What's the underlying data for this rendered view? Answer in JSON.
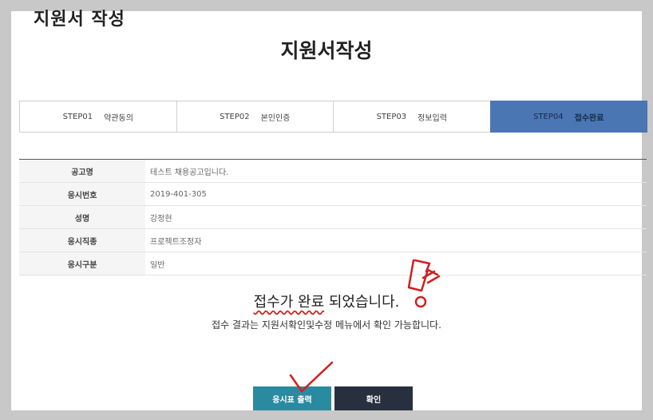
{
  "overlay_title": "지원서 작성",
  "page_title": "지원서작성",
  "steps": [
    {
      "num": "STEP01",
      "label": "약관동의"
    },
    {
      "num": "STEP02",
      "label": "본인인증"
    },
    {
      "num": "STEP03",
      "label": "정보입력"
    },
    {
      "num": "STEP04",
      "label": "접수완료"
    }
  ],
  "active_step": 4,
  "info": [
    {
      "label": "공고명",
      "value": "테스트 채용공고입니다."
    },
    {
      "label": "응시번호",
      "value": "2019-401-305"
    },
    {
      "label": "성명",
      "value": "강정현"
    },
    {
      "label": "응시직종",
      "value": "프로젝트조정자"
    },
    {
      "label": "응시구분",
      "value": "일반"
    }
  ],
  "message": {
    "highlight": "접수가 완료",
    "rest": " 되었습니다.",
    "sub": "접수 결과는 지원서확인및수정 메뉴에서 확인 가능합니다."
  },
  "buttons": {
    "print": "응시표 출력",
    "confirm": "확인"
  },
  "colors": {
    "active_step": "#4a76b4",
    "print_button": "#2a8aa0",
    "confirm_button": "#283040",
    "annotation": "#d21f1f"
  }
}
